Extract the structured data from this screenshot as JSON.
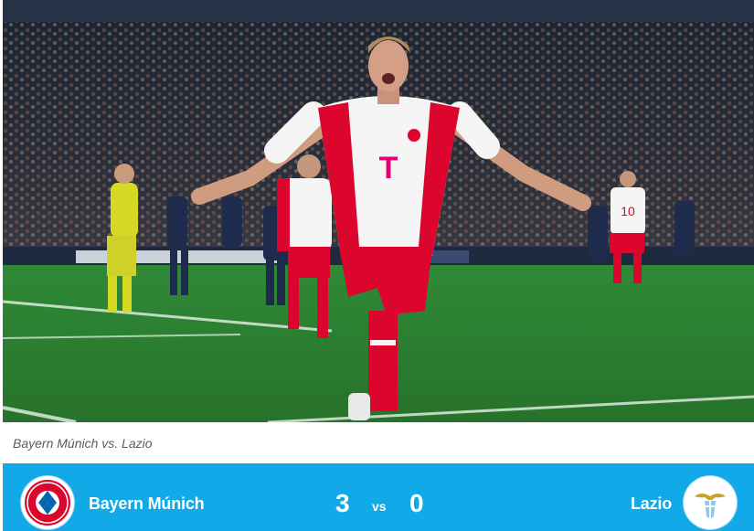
{
  "caption": "Bayern Múnich vs. Lazio",
  "match": {
    "home_team": "Bayern Múnich",
    "away_team": "Lazio",
    "home_score": "3",
    "away_score": "0",
    "vs_label": "vs",
    "home_crest_icon": "bayern-munich-crest-icon",
    "away_crest_icon": "lazio-eagle-crest-icon"
  },
  "photo": {
    "shirt_number_left": "",
    "shirt_number_right": "10"
  },
  "colors": {
    "score_bar": "#12a9e9",
    "bayern_red": "#dc052d",
    "pitch": "#2e7d32"
  }
}
